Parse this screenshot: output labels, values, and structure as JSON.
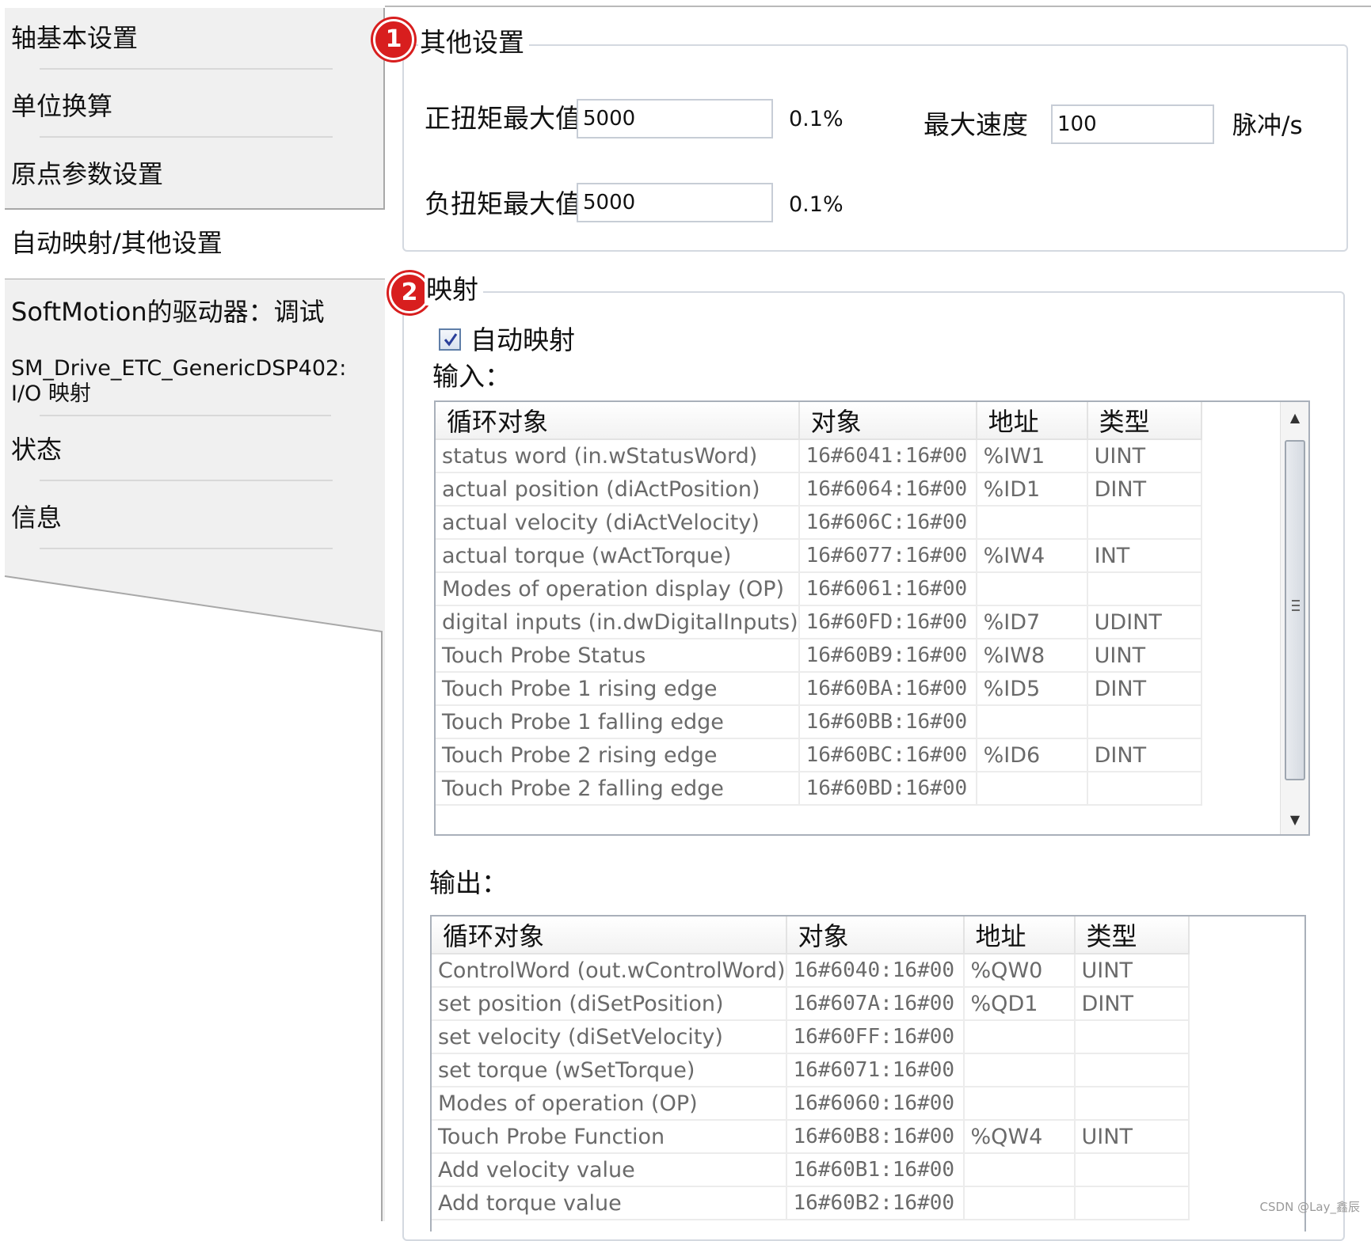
{
  "nav": {
    "items": [
      {
        "label": "轴基本设置"
      },
      {
        "label": "单位换算"
      },
      {
        "label": "原点参数设置"
      },
      {
        "label": "自动映射/其他设置"
      },
      {
        "label": "SoftMotion的驱动器：调试"
      },
      {
        "label": "SM_Drive_ETC_GenericDSP402: I/O 映射"
      },
      {
        "label": "状态"
      },
      {
        "label": "信息"
      }
    ],
    "selected_index": 3
  },
  "other_settings": {
    "marker": "1",
    "title": "其他设置",
    "pos_torque_label": "正扭矩最大值",
    "pos_torque_value": "5000",
    "pos_torque_unit": "0.1%",
    "neg_torque_label": "负扭矩最大值",
    "neg_torque_value": "5000",
    "neg_torque_unit": "0.1%",
    "max_speed_label": "最大速度",
    "max_speed_value": "100",
    "max_speed_unit": "脉冲/s"
  },
  "mapping": {
    "marker": "2",
    "title": "映射",
    "auto_map_label": "自动映射",
    "auto_map_checked": true,
    "input_label": "输入：",
    "output_label": "输出：",
    "columns": [
      "循环对象",
      "对象",
      "地址",
      "类型"
    ],
    "inputs": [
      [
        "status word (in.wStatusWord)",
        "16#6041:16#00",
        "%IW1",
        "UINT"
      ],
      [
        "actual position (diActPosition)",
        "16#6064:16#00",
        "%ID1",
        "DINT"
      ],
      [
        "actual velocity (diActVelocity)",
        "16#606C:16#00",
        "",
        ""
      ],
      [
        "actual torque (wActTorque)",
        "16#6077:16#00",
        "%IW4",
        "INT"
      ],
      [
        "Modes of operation display (OP)",
        "16#6061:16#00",
        "",
        ""
      ],
      [
        "digital inputs (in.dwDigitalInputs)",
        "16#60FD:16#00",
        "%ID7",
        "UDINT"
      ],
      [
        "Touch Probe Status",
        "16#60B9:16#00",
        "%IW8",
        "UINT"
      ],
      [
        "Touch Probe 1 rising edge",
        "16#60BA:16#00",
        "%ID5",
        "DINT"
      ],
      [
        "Touch Probe 1 falling edge",
        "16#60BB:16#00",
        "",
        ""
      ],
      [
        "Touch Probe 2 rising edge",
        "16#60BC:16#00",
        "%ID6",
        "DINT"
      ],
      [
        "Touch Probe 2 falling edge",
        "16#60BD:16#00",
        "",
        ""
      ]
    ],
    "outputs": [
      [
        "ControlWord (out.wControlWord)",
        "16#6040:16#00",
        "%QW0",
        "UINT"
      ],
      [
        "set position (diSetPosition)",
        "16#607A:16#00",
        "%QD1",
        "DINT"
      ],
      [
        "set velocity (diSetVelocity)",
        "16#60FF:16#00",
        "",
        ""
      ],
      [
        "set torque (wSetTorque)",
        "16#6071:16#00",
        "",
        ""
      ],
      [
        "Modes of operation (OP)",
        "16#6060:16#00",
        "",
        ""
      ],
      [
        "Touch Probe Function",
        "16#60B8:16#00",
        "%QW4",
        "UINT"
      ],
      [
        "Add velocity value",
        "16#60B1:16#00",
        "",
        ""
      ],
      [
        "Add torque value",
        "16#60B2:16#00",
        "",
        ""
      ]
    ]
  },
  "watermark": "CSDN @Lay_鑫辰"
}
